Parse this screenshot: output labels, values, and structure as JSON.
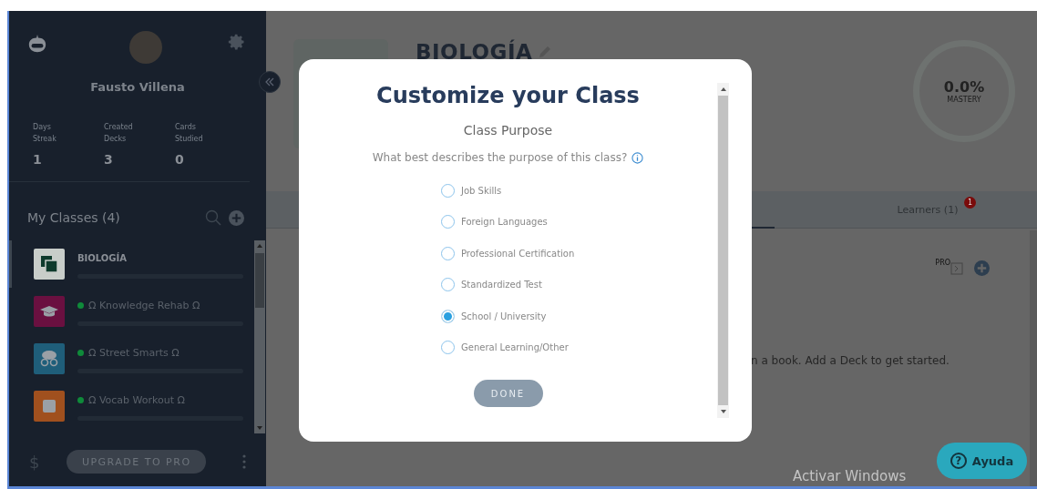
{
  "sidebar": {
    "user_name": "Fausto Villena",
    "stats": [
      {
        "label": "Days Streak",
        "value": "1"
      },
      {
        "label": "Created Decks",
        "value": "3"
      },
      {
        "label": "Cards Studied",
        "value": "0"
      }
    ],
    "classes_heading": "My Classes (4)",
    "classes": [
      {
        "name": "BIOLOGÍA",
        "selected": true,
        "status_dot": false,
        "color": "#c8cdc9",
        "kind": "squares"
      },
      {
        "name": "Ω Knowledge Rehab Ω",
        "selected": false,
        "status_dot": true,
        "color": "#6a1040",
        "kind": "cap"
      },
      {
        "name": "Ω Street Smarts Ω",
        "selected": false,
        "status_dot": true,
        "color": "#1f5e7a",
        "kind": "brain"
      },
      {
        "name": "Ω Vocab Workout Ω",
        "selected": false,
        "status_dot": true,
        "color": "#a0501e",
        "kind": "book"
      }
    ],
    "footer": {
      "currency": "$",
      "upgrade_button": "UPGRADE TO PRO"
    }
  },
  "class_header": {
    "title": "BIOLOGÍA",
    "mastery": {
      "value": "0.0%",
      "label": "MASTERY"
    }
  },
  "tabs": [
    {
      "label": "Learners (1)",
      "badge": "1"
    }
  ],
  "content": {
    "pro_label": "PRO",
    "empty_message": "n a book. Add a Deck to get started."
  },
  "modal": {
    "title": "Customize your Class",
    "subtitle": "Class Purpose",
    "question": "What best describes the purpose of this class?",
    "options": [
      {
        "label": "Job Skills",
        "selected": false
      },
      {
        "label": "Foreign Languages",
        "selected": false
      },
      {
        "label": "Professional Certification",
        "selected": false
      },
      {
        "label": "Standardized Test",
        "selected": false
      },
      {
        "label": "School / University",
        "selected": true
      },
      {
        "label": "General Learning/Other",
        "selected": false
      }
    ],
    "done_button": "DONE"
  },
  "help_button": "Ayuda",
  "help_icon": "?",
  "os_notice": "Activar Windows"
}
